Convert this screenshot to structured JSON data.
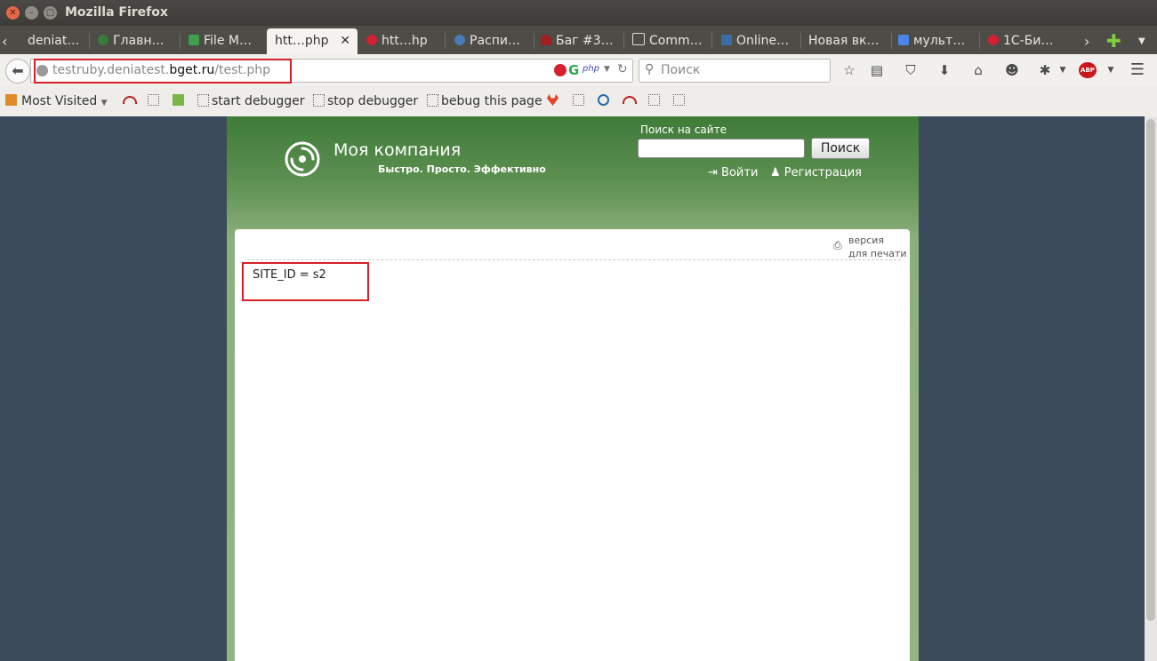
{
  "window": {
    "title": "Mozilla Firefox"
  },
  "tabs": [
    {
      "label": "deniat…"
    },
    {
      "label": "Главн…"
    },
    {
      "label": "File M…"
    },
    {
      "label": "htt…php",
      "active": true
    },
    {
      "label": "htt…hp"
    },
    {
      "label": "Распи…"
    },
    {
      "label": "Баг #3…"
    },
    {
      "label": "Comm…"
    },
    {
      "label": "Online…"
    },
    {
      "label": "Новая вк…"
    },
    {
      "label": "мульт…"
    },
    {
      "label": "1С-Би…"
    }
  ],
  "nav": {
    "url_host": "testruby.deniatest.",
    "url_domain": "bget.ru",
    "url_path": "/test.php",
    "search_placeholder": "Поиск"
  },
  "bookmarks": {
    "most_visited": "Most Visited",
    "start_debugger": "start debugger",
    "stop_debugger": "stop debugger",
    "debug_page": "bebug this page"
  },
  "site": {
    "company": "Моя компания",
    "slogan": "Быстро. Просто. Эффективно",
    "search_label": "Поиск на сайте",
    "search_button": "Поиск",
    "login": "Войти",
    "register": "Регистрация",
    "print_line1": "версия",
    "print_line2": "для печати",
    "content_text": "SITE_ID = s2"
  },
  "colors": {
    "highlight": "#d42026",
    "site_green": "#3f7b39",
    "page_bg": "#3b4b5c"
  }
}
